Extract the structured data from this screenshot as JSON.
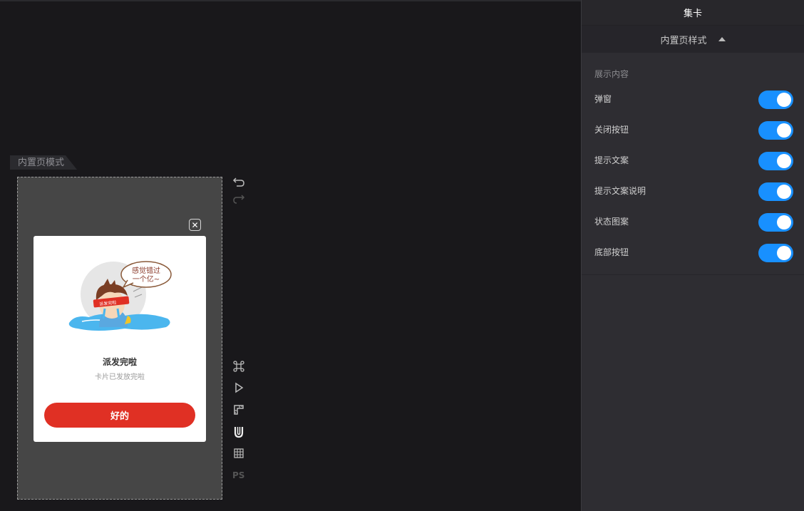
{
  "canvas": {
    "mode_label": "内置页模式",
    "popup": {
      "close_icon": "close-icon",
      "bubble_text_line1": "感觉错过",
      "bubble_text_line2": "一个亿~",
      "headband_text": "派发完啦",
      "title": "派发完啦",
      "description": "卡片已发放完啦",
      "button_label": "好的",
      "button_color": "#e03024"
    }
  },
  "toolbar": {
    "undo_icon": "undo-icon",
    "redo_icon": "redo-icon",
    "command_icon": "command-icon",
    "play_icon": "play-icon",
    "ruler_icon": "ruler-icon",
    "magnet_icon": "magnet-icon",
    "grid_icon": "grid-icon",
    "ps_label": "PS"
  },
  "panel": {
    "title": "集卡",
    "section_title": "内置页样式",
    "group_label": "展示内容",
    "toggle_color": "#1890ff",
    "items": [
      {
        "label": "弹窗",
        "on": true
      },
      {
        "label": "关闭按钮",
        "on": true
      },
      {
        "label": "提示文案",
        "on": true
      },
      {
        "label": "提示文案说明",
        "on": true
      },
      {
        "label": "状态图案",
        "on": true
      },
      {
        "label": "底部按钮",
        "on": true
      }
    ]
  }
}
